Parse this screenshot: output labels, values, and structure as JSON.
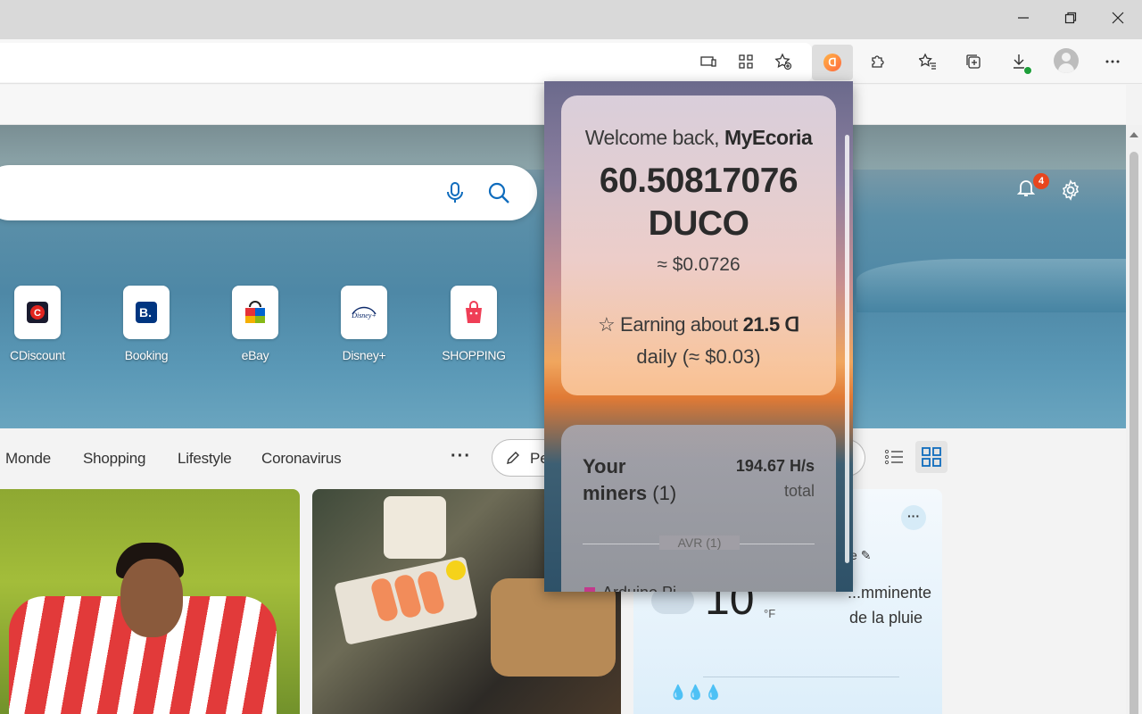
{
  "browser": {
    "window_controls": [
      "minimize",
      "restore",
      "close"
    ]
  },
  "shortcuts": [
    {
      "label": "CDiscount",
      "icon": "cdiscount-icon",
      "color": "#e2241f"
    },
    {
      "label": "Booking",
      "icon": "booking-icon",
      "color": "#003580"
    },
    {
      "label": "eBay",
      "icon": "ebay-icon",
      "color": "#e53238"
    },
    {
      "label": "Disney+",
      "icon": "disney-plus-icon",
      "color": "#0d2a6b"
    },
    {
      "label": "SHOPPING",
      "icon": "shopping-bag-icon",
      "color": "#ef3e56"
    }
  ],
  "notifications": {
    "count": "4"
  },
  "nav": {
    "items": [
      "Monde",
      "Shopping",
      "Lifestyle",
      "Coronavirus"
    ],
    "more": "···",
    "personalize": "Pe"
  },
  "weather": {
    "menu": "···",
    "ce": "ce",
    "temp": "10",
    "unit": "°F",
    "forecast_line1": "...mminente",
    "forecast_line2": "de la pluie",
    "drops": "💧💧💧"
  },
  "popup": {
    "welcome_prefix": "Welcome back, ",
    "username": "MyEcoria",
    "balance_amount": "60.50817076",
    "balance_currency": "DUCO",
    "balance_usd": "≈ $0.0726",
    "earning_prefix": "Earning about ",
    "earning_amount": "21.5",
    "earning_symbol": "ᗡ",
    "earning_daily": "daily (≈ $0.03)",
    "miners_title": "Your",
    "miners_label": "miners",
    "miners_count": "(1)",
    "hashrate": "194.67 H/s",
    "hashrate_label": "total",
    "group_label": "AVR (1)",
    "miner_row": "Arduino Pi..."
  },
  "colors": {
    "accent": "#0f6cbd",
    "badge": "#e8461e",
    "download_ok": "#1e9e3a"
  }
}
